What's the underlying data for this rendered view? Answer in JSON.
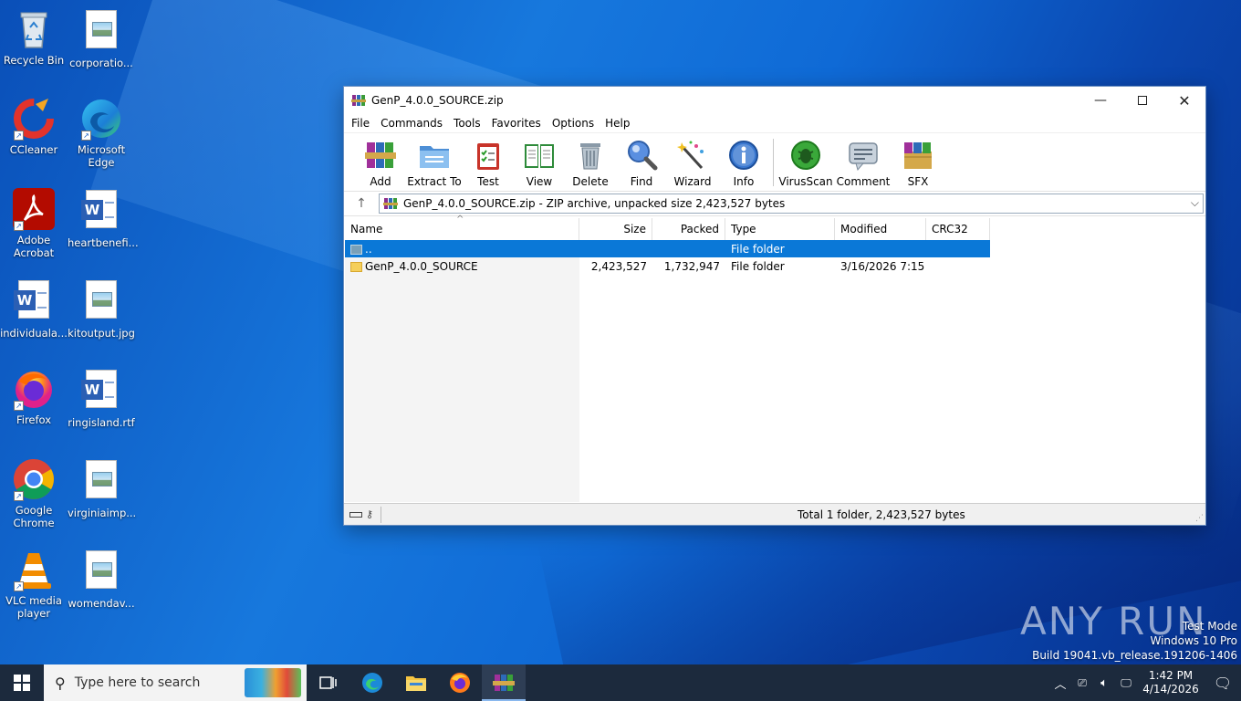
{
  "desktop": {
    "icons": [
      {
        "label": "Recycle Bin"
      },
      {
        "label": "corporatio..."
      },
      {
        "label": "CCleaner"
      },
      {
        "label": "Microsoft Edge"
      },
      {
        "label": "Adobe Acrobat"
      },
      {
        "label": "heartbenefi..."
      },
      {
        "label": "individuala..."
      },
      {
        "label": "kitoutput.jpg"
      },
      {
        "label": "Firefox"
      },
      {
        "label": "ringisland.rtf"
      },
      {
        "label": "Google Chrome"
      },
      {
        "label": "virginiaimp..."
      },
      {
        "label": "VLC media player"
      },
      {
        "label": "womendav..."
      }
    ]
  },
  "window": {
    "title": "GenP_4.0.0_SOURCE.zip",
    "menu": [
      "File",
      "Commands",
      "Tools",
      "Favorites",
      "Options",
      "Help"
    ],
    "toolbar": [
      "Add",
      "Extract To",
      "Test",
      "View",
      "Delete",
      "Find",
      "Wizard",
      "Info",
      "VirusScan",
      "Comment",
      "SFX"
    ],
    "address": "GenP_4.0.0_SOURCE.zip - ZIP archive, unpacked size 2,423,527 bytes",
    "columns": [
      "Name",
      "Size",
      "Packed",
      "Type",
      "Modified",
      "CRC32"
    ],
    "rows": [
      {
        "name": "..",
        "size": "",
        "packed": "",
        "type": "File folder",
        "modified": "",
        "crc": ""
      },
      {
        "name": "GenP_4.0.0_SOURCE",
        "size": "2,423,527",
        "packed": "1,732,947",
        "type": "File folder",
        "modified": "3/16/2026 7:15 ...",
        "crc": ""
      }
    ],
    "status": "Total 1 folder, 2,423,527 bytes"
  },
  "taskbar": {
    "search_placeholder": "Type here to search",
    "time": "1:42 PM",
    "date": "4/14/2026"
  },
  "watermark": {
    "line1": "Test Mode",
    "line2": "Windows 10 Pro",
    "line3": "Build 19041.vb_release.191206-1406",
    "brand": "ANY RUN"
  },
  "colors": {
    "selection": "#0a78d7",
    "taskbar": "#1c2a3d"
  }
}
